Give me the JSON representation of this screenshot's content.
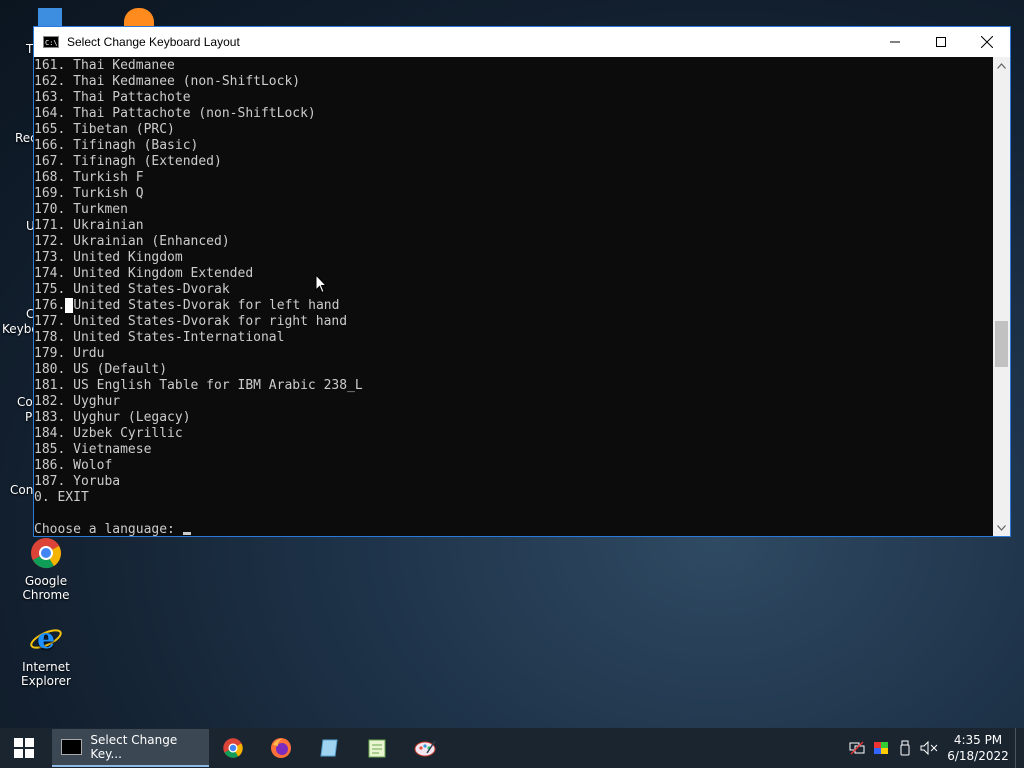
{
  "window": {
    "title": "Select Change Keyboard Layout",
    "icon_label": "C:\\"
  },
  "console": {
    "lines": [
      "161. Thai Kedmanee",
      "162. Thai Kedmanee (non-ShiftLock)",
      "163. Thai Pattachote",
      "164. Thai Pattachote (non-ShiftLock)",
      "165. Tibetan (PRC)",
      "166. Tifinagh (Basic)",
      "167. Tifinagh (Extended)",
      "168. Turkish F",
      "169. Turkish Q",
      "170. Turkmen",
      "171. Ukrainian",
      "172. Ukrainian (Enhanced)",
      "173. United Kingdom",
      "174. United Kingdom Extended",
      "175. United States-Dvorak",
      "176.",
      "177. United States-Dvorak for right hand",
      "178. United States-International",
      "179. Urdu",
      "180. US (Default)",
      "181. US English Table for IBM Arabic 238_L",
      "182. Uyghur",
      "183. Uyghur (Legacy)",
      "184. Uzbek Cyrillic",
      "185. Vietnamese",
      "186. Wolof",
      "187. Yoruba",
      "0. EXIT",
      "",
      "Choose a language: "
    ],
    "line176_rest": "United States-Dvorak for left hand"
  },
  "desktop": {
    "icons": [
      {
        "label": "Google Chrome"
      },
      {
        "label": "Internet Explorer"
      }
    ],
    "fragments": [
      "T",
      "Rec",
      "U",
      "C",
      "Keybo",
      "Co",
      "P",
      "Con"
    ]
  },
  "taskbar": {
    "active_task": "Select Change Key...",
    "time": "4:35 PM",
    "date": "6/18/2022"
  },
  "colors": {
    "console_bg": "#0c0c0c",
    "console_fg": "#cccccc",
    "taskbar_bg": "#1b2530",
    "accent": "#2b79d8"
  },
  "icons": {
    "start": "windows-logo-icon",
    "chrome": "chrome-icon",
    "firefox": "firefox-icon",
    "notepad": "notepad-icon",
    "editor": "editor-icon",
    "paint": "paint-icon"
  }
}
